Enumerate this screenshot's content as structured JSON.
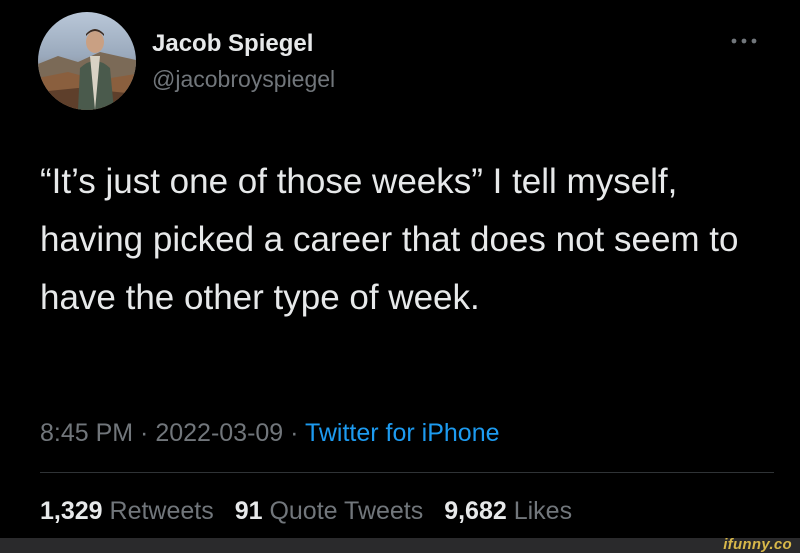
{
  "author": {
    "name": "Jacob Spiegel",
    "handle": "@jacobroyspiegel"
  },
  "more_icon": "more-horizontal-icon",
  "tweet": {
    "text": "“It’s just one of those weeks” I tell myself, having picked a career that does not seem to have the other type of week."
  },
  "meta": {
    "time": "8:45 PM",
    "separator": " · ",
    "date": "2022-03-09",
    "source": "Twitter for iPhone"
  },
  "stats": {
    "retweets_count": "1,329",
    "retweets_label": "Retweets",
    "quotes_count": "91",
    "quotes_label": "Quote Tweets",
    "likes_count": "9,682",
    "likes_label": "Likes"
  },
  "watermark": "ifunny.co",
  "colors": {
    "background": "#000000",
    "text_primary": "#e7e9ea",
    "text_secondary": "#71767b",
    "accent": "#1d9bf0",
    "divider": "#2f3336"
  }
}
